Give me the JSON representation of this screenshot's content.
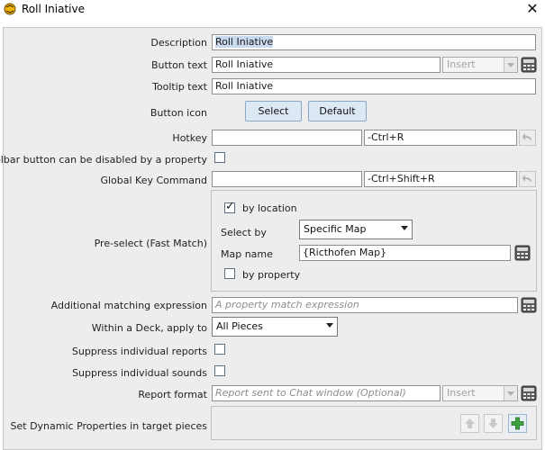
{
  "window": {
    "title": "Roll Iniative",
    "close_glyph": "✕"
  },
  "labels": {
    "description": "Description",
    "button_text": "Button text",
    "tooltip_text": "Tooltip text",
    "button_icon": "Button icon",
    "hotkey": "Hotkey",
    "toolbar_disable": "Toolbar button can be disabled by a property",
    "global_key_command": "Global Key Command",
    "preselect": "Pre-select (Fast Match)",
    "additional_matching": "Additional matching expression",
    "within_deck": "Within a Deck, apply to",
    "suppress_reports": "Suppress individual reports",
    "suppress_sounds": "Suppress individual sounds",
    "report_format": "Report format",
    "dynamic_properties": "Set Dynamic Properties in target pieces"
  },
  "fields": {
    "description": "Roll Iniative",
    "button_text": "Roll Iniative",
    "tooltip_text": "Roll Iniative",
    "hotkey": "",
    "hotkey_display": "-Ctrl+R",
    "global_key": "",
    "global_key_display": "-Ctrl+Shift+R",
    "additional_matching_placeholder": "A property match expression",
    "report_format_placeholder": "Report sent to Chat window (Optional)"
  },
  "combos": {
    "button_text_insert": "Insert",
    "report_insert": "Insert",
    "within_deck": "All Pieces"
  },
  "buttons": {
    "select": "Select",
    "default": "Default"
  },
  "checkboxes": {
    "toolbar_disable": false,
    "suppress_reports": false,
    "suppress_sounds": false
  },
  "preselect": {
    "by_location_label": "by location",
    "by_location": true,
    "select_by_label": "Select by",
    "select_by_value": "Specific Map",
    "map_name_label": "Map name",
    "map_name_value": "{Ricthofen Map}",
    "by_property_label": "by property",
    "by_property": false
  },
  "icons": {
    "app": "vassal-app-icon",
    "calculator": "calculator-icon",
    "undo": "undo-icon",
    "move_up": "arrow-up-icon",
    "move_down": "arrow-down-icon",
    "add": "plus-icon"
  },
  "colors": {
    "accent_green": "#2e9b2e",
    "selection": "#c9d9ee"
  }
}
